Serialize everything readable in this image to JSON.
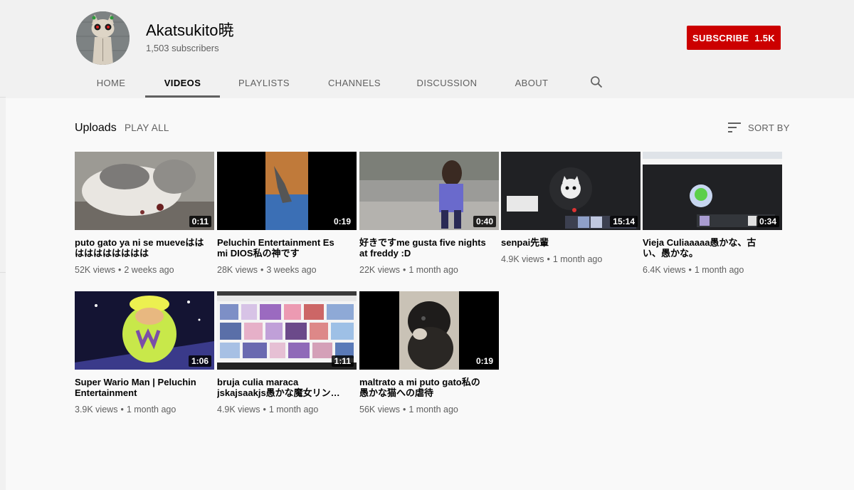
{
  "channel": {
    "name": "Akatsukito暁",
    "subscribers": "1,503 subscribers",
    "subscribe_label": "SUBSCRIBE",
    "subscribe_count": "1.5K"
  },
  "tabs": [
    {
      "label": "HOME"
    },
    {
      "label": "VIDEOS"
    },
    {
      "label": "PLAYLISTS"
    },
    {
      "label": "CHANNELS"
    },
    {
      "label": "DISCUSSION"
    },
    {
      "label": "ABOUT"
    }
  ],
  "active_tab": "VIDEOS",
  "section": {
    "title": "Uploads",
    "play_all": "PLAY ALL",
    "sort_by": "SORT BY"
  },
  "videos": [
    {
      "title": "puto gato ya ni se mueveはははははははははは",
      "views": "52K views",
      "age": "2 weeks ago",
      "duration": "0:11"
    },
    {
      "title": "Peluchin Entertainment Es mi DIOS私の神です",
      "views": "28K views",
      "age": "3 weeks ago",
      "duration": "0:19"
    },
    {
      "title": "好きですme gusta five nights at freddy :D",
      "views": "22K views",
      "age": "1 month ago",
      "duration": "0:40"
    },
    {
      "title": "senpai先輩",
      "views": "4.9K views",
      "age": "1 month ago",
      "duration": "15:14"
    },
    {
      "title": "Vieja Culiaaaaa愚かな、古い、愚かな。",
      "views": "6.4K views",
      "age": "1 month ago",
      "duration": "0:34"
    },
    {
      "title": "Super Wario Man | Peluchin Entertainment",
      "views": "3.9K views",
      "age": "1 month ago",
      "duration": "1:06"
    },
    {
      "title": "bruja culia maraca jskajsaakjs愚かな魔女リン…",
      "views": "4.9K views",
      "age": "1 month ago",
      "duration": "1:11"
    },
    {
      "title": "maltrato a mi puto gato私の愚かな猫への虐待",
      "views": "56K views",
      "age": "1 month ago",
      "duration": "0:19"
    }
  ],
  "colors": {
    "subscribe_bg": "#cc0000",
    "header_bg": "#f1f1f1",
    "page_bg": "#f9f9f9",
    "secondary_text": "#606060"
  },
  "icons": {
    "search": "search-icon",
    "sort": "sort-icon"
  }
}
